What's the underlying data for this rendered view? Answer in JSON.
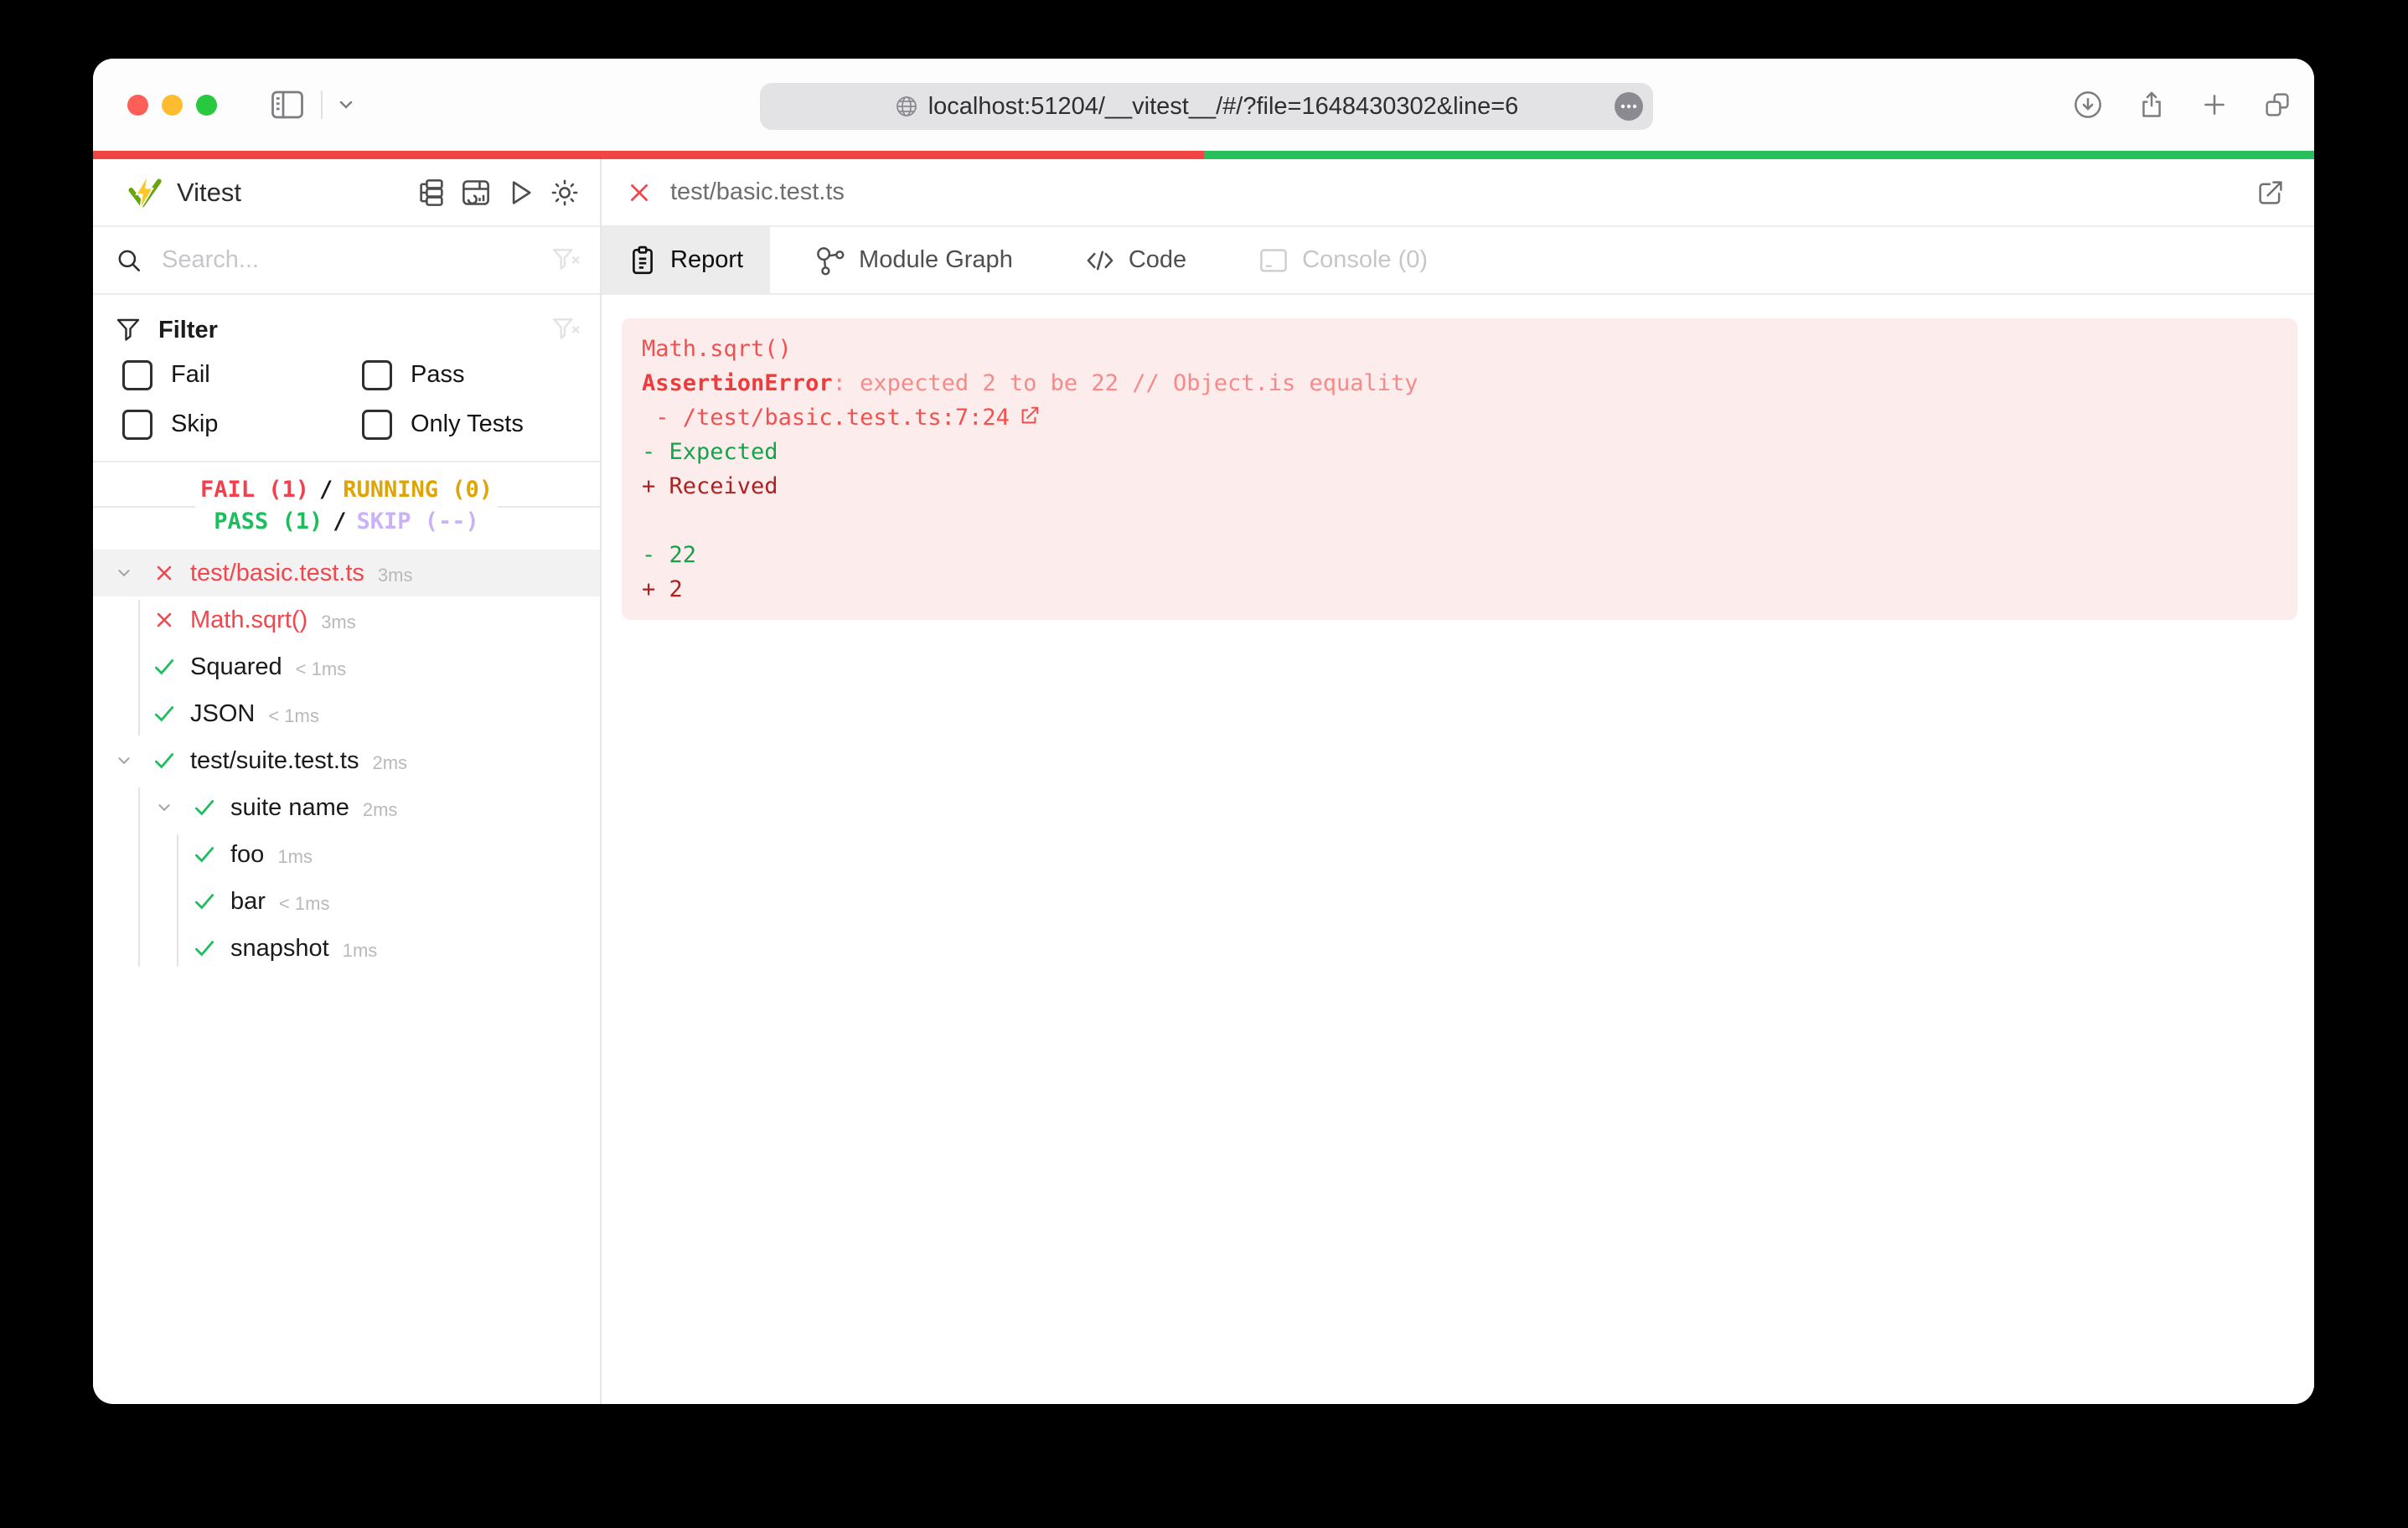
{
  "browser": {
    "url": "localhost:51204/__vitest__/#/?file=1648430302&line=6"
  },
  "progress": {
    "fail_percent": 50,
    "pass_percent": 50,
    "fail_color": "#f14444",
    "pass_color": "#27c05d"
  },
  "app": {
    "title": "Vitest"
  },
  "sidebar": {
    "search_placeholder": "Search...",
    "filter": {
      "label": "Filter",
      "options": [
        "Fail",
        "Pass",
        "Skip",
        "Only Tests"
      ]
    },
    "summary": {
      "line1": [
        {
          "text": "FAIL (1)",
          "color": "#f0414d"
        },
        {
          "text": "/",
          "color": "#1b1b1b"
        },
        {
          "text": "RUNNING (0)",
          "color": "#dfa408"
        }
      ],
      "line2": [
        {
          "text": "PASS (1)",
          "color": "#1dbd5e"
        },
        {
          "text": "/",
          "color": "#1b1b1b"
        },
        {
          "text": "SKIP (--)",
          "color": "#cbb1f7"
        }
      ]
    },
    "tree": [
      {
        "label": "test/basic.test.ts",
        "time": "3ms",
        "status": "fail",
        "indent": 0,
        "chevron": true,
        "selected": true
      },
      {
        "label": "Math.sqrt()",
        "time": "3ms",
        "status": "fail",
        "indent": 1,
        "chevron": false,
        "selected": false
      },
      {
        "label": "Squared",
        "time": "< 1ms",
        "status": "pass",
        "indent": 1,
        "chevron": false,
        "selected": false
      },
      {
        "label": "JSON",
        "time": "< 1ms",
        "status": "pass",
        "indent": 1,
        "chevron": false,
        "selected": false
      },
      {
        "label": "test/suite.test.ts",
        "time": "2ms",
        "status": "pass",
        "indent": 0,
        "chevron": true,
        "selected": false
      },
      {
        "label": "suite name",
        "time": "2ms",
        "status": "pass",
        "indent": 1,
        "chevron": true,
        "selected": false
      },
      {
        "label": "foo",
        "time": "1ms",
        "status": "pass",
        "indent": 2,
        "chevron": false,
        "selected": false
      },
      {
        "label": "bar",
        "time": "< 1ms",
        "status": "pass",
        "indent": 2,
        "chevron": false,
        "selected": false
      },
      {
        "label": "snapshot",
        "time": "1ms",
        "status": "pass",
        "indent": 2,
        "chevron": false,
        "selected": false
      }
    ]
  },
  "main": {
    "file_tab": {
      "label": "test/basic.test.ts"
    },
    "tabs": [
      {
        "label": "Report",
        "icon": "clipboard-icon",
        "state": "active"
      },
      {
        "label": "Module Graph",
        "icon": "graph-icon",
        "state": "normal"
      },
      {
        "label": "Code",
        "icon": "code-icon",
        "state": "normal"
      },
      {
        "label": "Console (0)",
        "icon": "console-icon",
        "state": "disabled"
      }
    ],
    "report": {
      "test_name": "Math.sqrt()",
      "error_name": "AssertionError",
      "error_message": ": expected 2 to be 22 // Object.is equality",
      "stack_prefix": " - ",
      "stack_link": "/test/basic.test.ts:7:24",
      "diff_expected_label": "- Expected",
      "diff_received_label": "+ Received",
      "diff_expected_value": "- 22",
      "diff_received_value": "+ 2"
    }
  }
}
